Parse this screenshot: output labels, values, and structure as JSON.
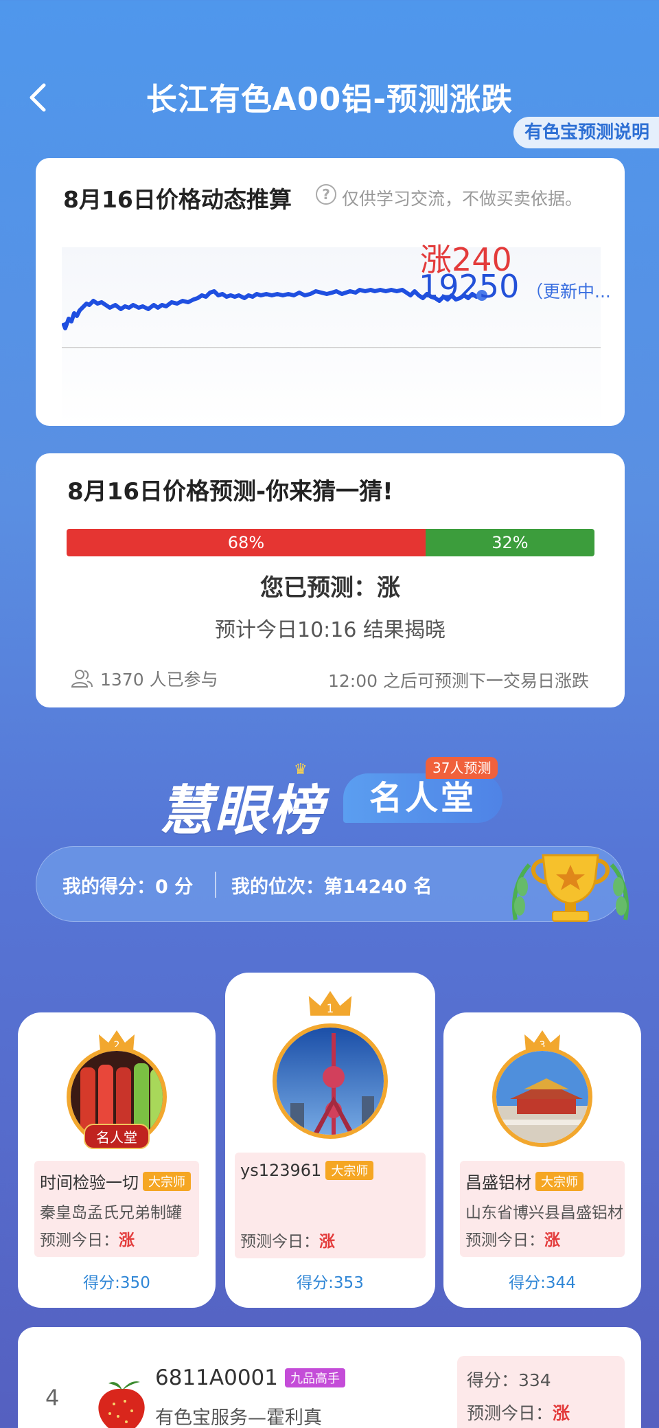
{
  "header": {
    "title": "长江有色A00铝-预测涨跌",
    "explain_label": "有色宝预测说明"
  },
  "trend": {
    "title": "8月16日价格动态推算",
    "disclaimer": "仅供学习交流，不做买卖依据。",
    "change": "涨240",
    "price": "19250",
    "update_status": "（更新中...",
    "line_color": "#1f4fe0"
  },
  "prediction": {
    "title": "8月16日价格预测-你来猜一猜!",
    "up_percent": "68%",
    "down_percent": "32%",
    "up_share": 0.68,
    "my_prediction": "您已预测：涨",
    "reveal": "预计今日10:16 结果揭晓",
    "participants": "1370 人已参与",
    "next_info": "12:00 之后可预测下一交易日涨跌"
  },
  "leaderboard": {
    "logo_text": "慧眼榜",
    "fame_label": "名人堂",
    "fame_count": "37人预测",
    "my_score": "我的得分：0 分",
    "my_rank": "我的位次：第14240 名"
  },
  "podium": [
    {
      "rank": "2",
      "name": "时间检验一切",
      "level": "大宗师",
      "company": "秦皇岛孟氏兄弟制罐",
      "pred_label": "预测今日：",
      "pred_value": "涨",
      "score": "得分:350",
      "fame_tag": "名人堂"
    },
    {
      "rank": "1",
      "name": "ys123961",
      "level": "大宗师",
      "company": "",
      "pred_label": "预测今日：",
      "pred_value": "涨",
      "score": "得分:353"
    },
    {
      "rank": "3",
      "name": "昌盛铝材",
      "level": "大宗师",
      "company": "山东省博兴县昌盛铝材",
      "pred_label": "预测今日：",
      "pred_value": "涨",
      "score": "得分:344"
    }
  ],
  "rank4": {
    "rank": "4",
    "name": "6811A0001",
    "level": "九品高手",
    "company": "有色宝服务—霍利真",
    "score": "得分：334",
    "pred_label": "预测今日：",
    "pred_value": "涨"
  }
}
